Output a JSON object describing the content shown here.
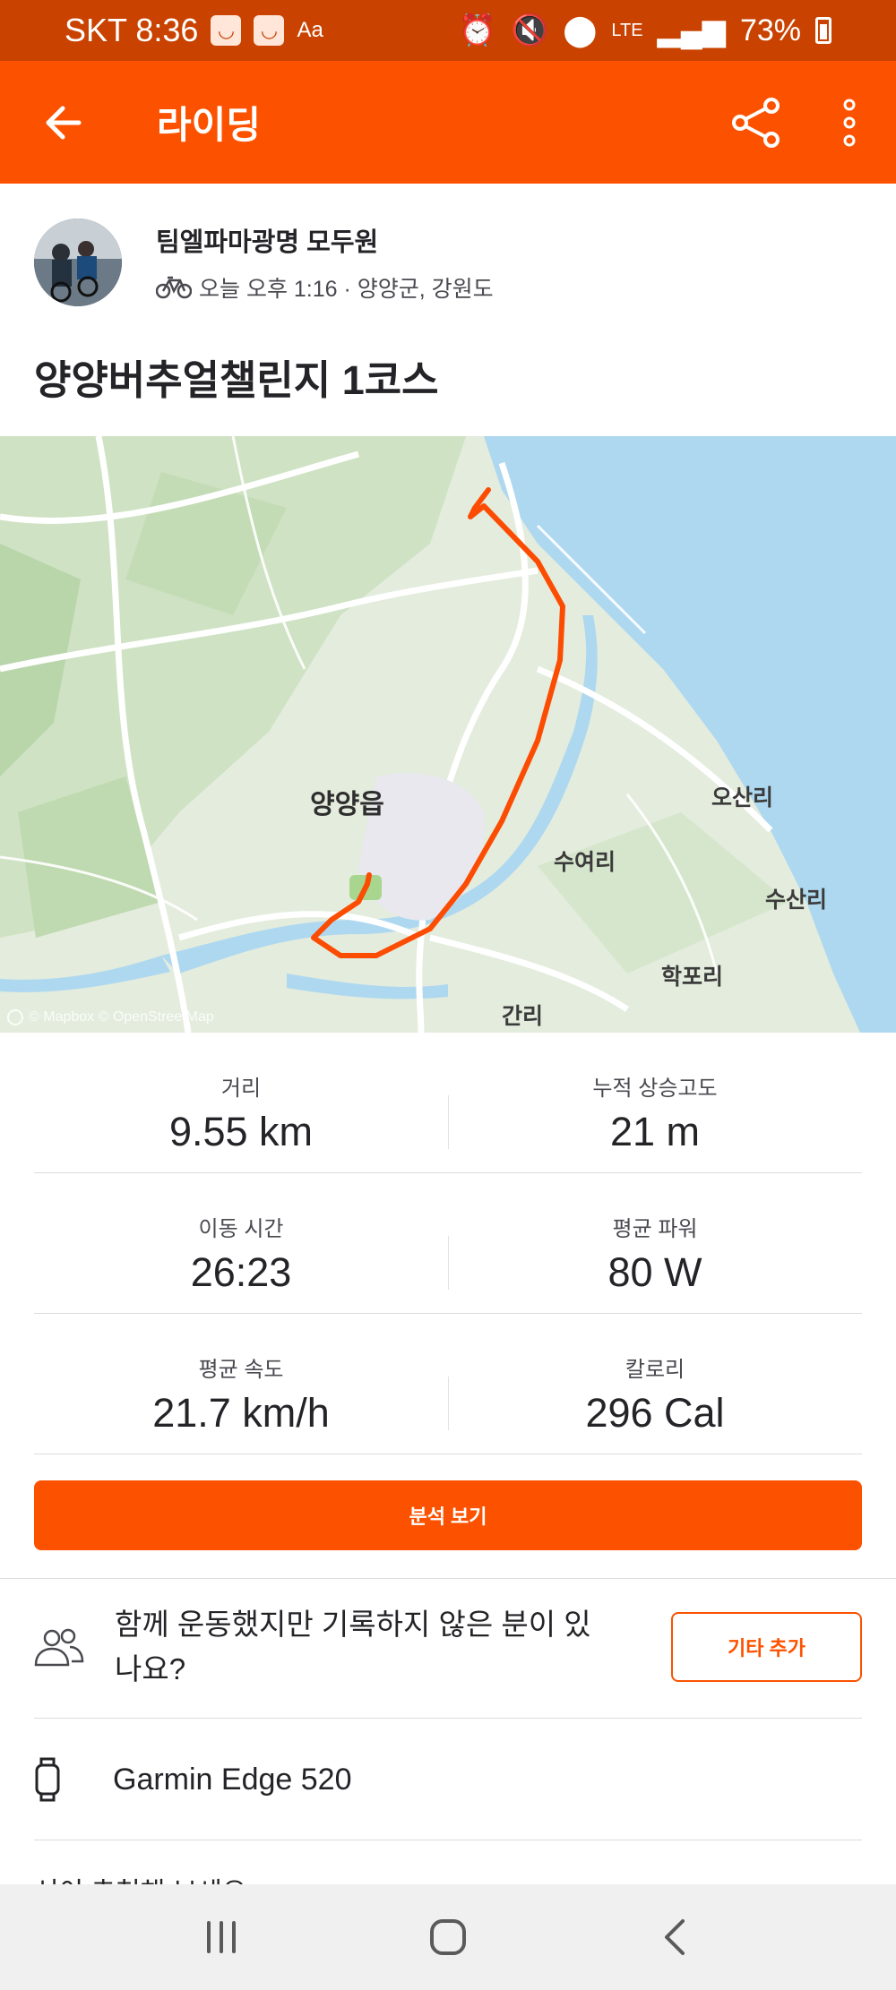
{
  "status_bar": {
    "carrier_time": "SKT 8:36",
    "network": "LTE",
    "battery": "73%"
  },
  "app_bar": {
    "title": "라이딩"
  },
  "activity": {
    "athlete_name": "팀엘파마광명 모두원",
    "meta": "오늘 오후 1:16 · 양양군, 강원도",
    "title": "양양버추얼챌린지 1코스"
  },
  "map": {
    "labels": {
      "town": "양양읍",
      "osan": "오산리",
      "suyeo": "수여리",
      "susan": "수산리",
      "hakpo": "학포리",
      "gan": "간리"
    },
    "credit": "© Mapbox © OpenStreetMap",
    "route_color": "#fc4c02",
    "water_color": "#aed8f0"
  },
  "stats": [
    {
      "label": "거리",
      "value": "9.55 km"
    },
    {
      "label": "누적 상승고도",
      "value": "21 m"
    },
    {
      "label": "이동 시간",
      "value": "26:23"
    },
    {
      "label": "평균 파워",
      "value": "80 W"
    },
    {
      "label": "평균 속도",
      "value": "21.7 km/h"
    },
    {
      "label": "칼로리",
      "value": "296 Cal"
    }
  ],
  "analysis_button": "분석 보기",
  "group": {
    "text": "함께 운동했지만 기록하지 않은 분이 있나요?",
    "add_button": "기타 추가"
  },
  "device": {
    "name": "Garmin Edge 520"
  },
  "peek": "선이 추천해 보세요"
}
